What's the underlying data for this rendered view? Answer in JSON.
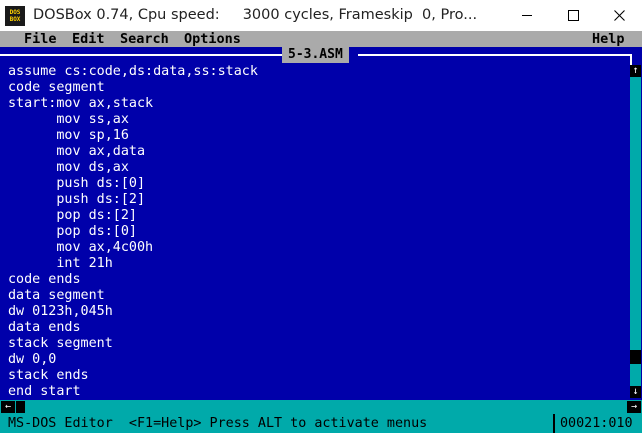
{
  "window": {
    "title": "DOSBox 0.74, Cpu speed:     3000 cycles, Frameskip  0, Pro..."
  },
  "menu": {
    "items": [
      {
        "label": "File"
      },
      {
        "label": "Edit"
      },
      {
        "label": "Search"
      },
      {
        "label": "Options"
      }
    ],
    "help": "Help"
  },
  "editor": {
    "filename": "5-3.ASM",
    "lines": [
      "assume cs:code,ds:data,ss:stack",
      "code segment",
      "start:mov ax,stack",
      "      mov ss,ax",
      "      mov sp,16",
      "      mov ax,data",
      "      mov ds,ax",
      "      push ds:[0]",
      "      push ds:[2]",
      "      pop ds:[2]",
      "      pop ds:[0]",
      "      mov ax,4c00h",
      "      int 21h",
      "code ends",
      "data segment",
      "dw 0123h,045h",
      "data ends",
      "stack segment",
      "dw 0,0",
      "stack ends",
      "end start"
    ]
  },
  "status": {
    "text": "MS-DOS Editor  <F1=Help> Press ALT to activate menus",
    "cursor": "00021:010"
  },
  "colors": {
    "editor_bg": "#0000aa",
    "menu_bg": "#aaaaaa",
    "status_bg": "#00aaaa",
    "text": "#ffffff"
  }
}
